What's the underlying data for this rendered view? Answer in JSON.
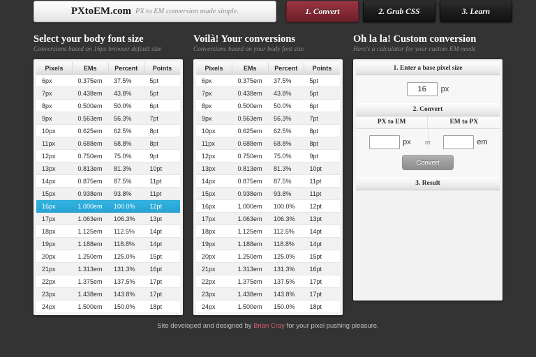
{
  "header": {
    "logo_name": "PXtoEM.com",
    "logo_tagline": "PX to EM conversion made simple.",
    "tabs": [
      {
        "label": "1. Convert",
        "active": true
      },
      {
        "label": "2. Grab CSS",
        "active": false
      },
      {
        "label": "3. Learn",
        "active": false
      }
    ]
  },
  "sections": {
    "select": {
      "title": "Select your body font size",
      "subtitle": "Conversions based on 16px browser default size"
    },
    "conversions": {
      "title": "Voilà! Your conversions",
      "subtitle": "Conversions based on your body font size"
    },
    "custom": {
      "title": "Oh la la! Custom conversion",
      "subtitle": "Here's a calculator for your custom EM needs"
    }
  },
  "table": {
    "columns": [
      "Pixels",
      "EMs",
      "Percent",
      "Points"
    ],
    "highlighted_pixels": "16px",
    "rows": [
      [
        "6px",
        "0.375em",
        "37.5%",
        "5pt"
      ],
      [
        "7px",
        "0.438em",
        "43.8%",
        "5pt"
      ],
      [
        "8px",
        "0.500em",
        "50.0%",
        "6pt"
      ],
      [
        "9px",
        "0.563em",
        "56.3%",
        "7pt"
      ],
      [
        "10px",
        "0.625em",
        "62.5%",
        "8pt"
      ],
      [
        "11px",
        "0.688em",
        "68.8%",
        "8pt"
      ],
      [
        "12px",
        "0.750em",
        "75.0%",
        "9pt"
      ],
      [
        "13px",
        "0.813em",
        "81.3%",
        "10pt"
      ],
      [
        "14px",
        "0.875em",
        "87.5%",
        "11pt"
      ],
      [
        "15px",
        "0.938em",
        "93.8%",
        "11pt"
      ],
      [
        "16px",
        "1.000em",
        "100.0%",
        "12pt"
      ],
      [
        "17px",
        "1.063em",
        "106.3%",
        "13pt"
      ],
      [
        "18px",
        "1.125em",
        "112.5%",
        "14pt"
      ],
      [
        "19px",
        "1.188em",
        "118.8%",
        "14pt"
      ],
      [
        "20px",
        "1.250em",
        "125.0%",
        "15pt"
      ],
      [
        "21px",
        "1.313em",
        "131.3%",
        "16pt"
      ],
      [
        "22px",
        "1.375em",
        "137.5%",
        "17pt"
      ],
      [
        "23px",
        "1.438em",
        "143.8%",
        "17pt"
      ],
      [
        "24px",
        "1.500em",
        "150.0%",
        "18pt"
      ]
    ]
  },
  "calculator": {
    "step1_label": "1. Enter a base pixel size",
    "base_value": "16",
    "base_unit": "px",
    "step2_label": "2. Convert",
    "px_to_em_label": "PX to EM",
    "em_to_px_label": "EM to PX",
    "px_input_value": "",
    "px_unit": "px",
    "or_label": "or",
    "em_input_value": "",
    "em_unit": "em",
    "convert_button": "Convert",
    "step3_label": "3. Result",
    "result_value": ""
  },
  "footer": {
    "prefix": "Site developed and designed by ",
    "author": "Brian Cray",
    "suffix": " for your pixel pushing pleasure."
  },
  "colors": {
    "background": "#333333",
    "accent_blue": "#29a8d8",
    "accent_red": "#842a35",
    "link_red": "#d8606e"
  }
}
